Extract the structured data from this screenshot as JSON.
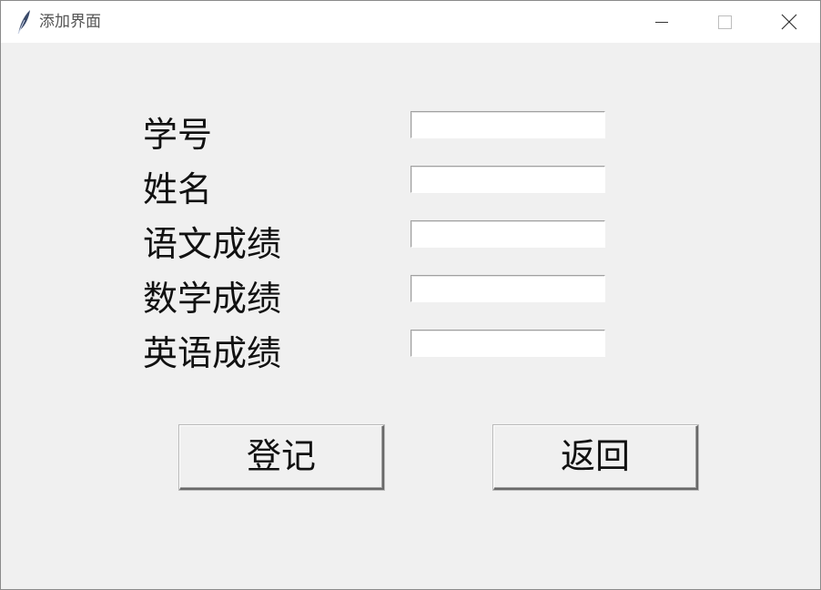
{
  "window": {
    "title": "添加界面",
    "colors": {
      "background": "#f0f0f0",
      "titlebar": "#ffffff",
      "input": "#ffffff",
      "text": "#111111"
    }
  },
  "form": {
    "fields": [
      {
        "label": "学号",
        "value": ""
      },
      {
        "label": "姓名",
        "value": ""
      },
      {
        "label": "语文成绩",
        "value": ""
      },
      {
        "label": "数学成绩",
        "value": ""
      },
      {
        "label": "英语成绩",
        "value": ""
      }
    ]
  },
  "actions": {
    "register_label": "登记",
    "back_label": "返回"
  }
}
